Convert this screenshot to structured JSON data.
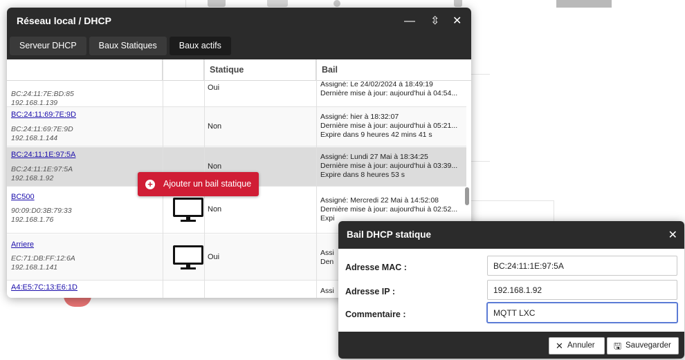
{
  "window": {
    "title": "Réseau local / DHCP",
    "tabs": [
      "Serveur DHCP",
      "Baux Statiques",
      "Baux actifs"
    ],
    "controls": {
      "minimize": "—",
      "maximize": "⇳",
      "close": "✕"
    }
  },
  "table": {
    "headers": {
      "mac": "",
      "icon": "",
      "statique": "Statique",
      "bail": "Bail"
    },
    "rows": [
      {
        "link": "",
        "mac": "BC:24:11:7E:BD:85",
        "ip": "192.168.1.139",
        "statique": "Oui",
        "bail": [
          "Assigné: Le 24/02/2024 à 18:49:19",
          "Dernière mise à jour: aujourd'hui à 04:54..."
        ]
      },
      {
        "link": "BC:24:11:69:7E:9D",
        "mac": "BC:24:11:69:7E:9D",
        "ip": "192.168.1.144",
        "statique": "Non",
        "bail": [
          "Assigné: hier à 18:32:07",
          "Dernière mise à jour: aujourd'hui à 05:21...",
          "Expire dans 9 heures 42 mins 41 s"
        ]
      },
      {
        "link": "BC:24:11:1E:97:5A",
        "mac": "BC:24:11:1E:97:5A",
        "ip": "192.168.1.92",
        "statique": "Non",
        "bail": [
          "Assigné: Lundi 27 Mai à 18:34:25",
          "Dernière mise à jour: aujourd'hui à 03:39...",
          "Expire dans 8 heures 53 s"
        ]
      },
      {
        "link": "BC500",
        "mac": "90:09:D0:3B:79:33",
        "ip": "192.168.1.76",
        "statique": "Non",
        "bail": [
          "Assigné: Mercredi 22 Mai à 14:52:08",
          "Dernière mise à jour: aujourd'hui à 02:52...",
          "Expi"
        ]
      },
      {
        "link": "Arriere",
        "mac": "EC:71:DB:FF:12:6A",
        "ip": "192.168.1.141",
        "statique": "Oui",
        "bail": [
          "Assi",
          "Den"
        ]
      },
      {
        "link": "A4:E5:7C:13:E6:1D",
        "mac": "",
        "ip": "",
        "statique": "",
        "bail": [
          "Assi"
        ]
      }
    ]
  },
  "context_button": {
    "label": "Ajouter un bail statique",
    "icon": "plus-circle-icon",
    "color": "#d01d35"
  },
  "dialog": {
    "title": "Bail DHCP statique",
    "mac_label": "Adresse MAC :",
    "mac_value": "BC:24:11:1E:97:5A",
    "ip_label": "Adresse IP :",
    "ip_value": "192.168.1.92",
    "comment_label": "Commentaire :",
    "comment_value": "MQTT LXC",
    "cancel_label": "Annuler",
    "save_label": "Sauvegarder"
  },
  "colors": {
    "titlebar": "#2b2b2b",
    "accent_red": "#d01d35",
    "link": "#1a0dab"
  }
}
